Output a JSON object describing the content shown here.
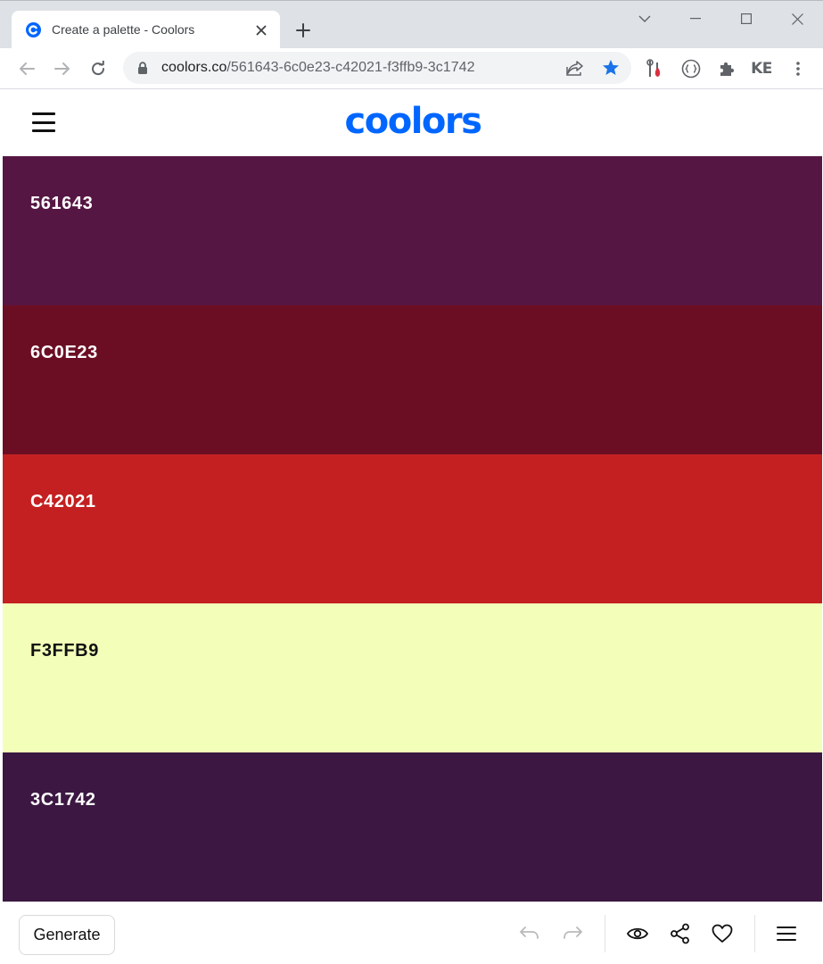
{
  "browser": {
    "tab": {
      "title": "Create a palette - Coolors",
      "favicon": "coolors-c-icon"
    },
    "address_bar": {
      "host": "coolors.co",
      "path": "/561643-6c0e23-c42021-f3ffb9-3c1742"
    },
    "profile_initials": "KE"
  },
  "site": {
    "logo_text": "coolors",
    "brand_color": "#0066ff"
  },
  "palette": [
    {
      "hex_label": "561643",
      "color": "#561643",
      "text_color": "#ffffff"
    },
    {
      "hex_label": "6C0E23",
      "color": "#6C0E23",
      "text_color": "#ffffff"
    },
    {
      "hex_label": "C42021",
      "color": "#C42021",
      "text_color": "#ffffff"
    },
    {
      "hex_label": "F3FFB9",
      "color": "#F3FFB9",
      "text_color": "#111111"
    },
    {
      "hex_label": "3C1742",
      "color": "#3C1742",
      "text_color": "#ffffff"
    }
  ],
  "bottom_bar": {
    "generate_label": "Generate",
    "icons": [
      "undo-icon",
      "redo-icon",
      "eye-icon",
      "share-icon",
      "heart-icon",
      "menu-icon"
    ]
  }
}
